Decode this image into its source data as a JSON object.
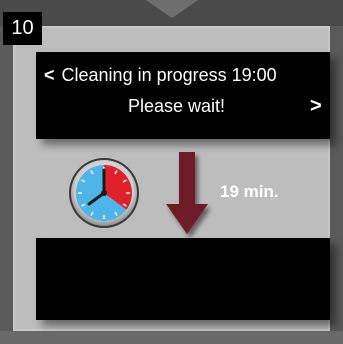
{
  "step": {
    "number": "10"
  },
  "display": {
    "prev_chevron": "<",
    "line1": "Cleaning in progress 19:00",
    "line2": "Please wait!",
    "next_chevron": ">"
  },
  "timer": {
    "remaining": "19 min."
  },
  "icons": {
    "clock": "stopwatch-clock-icon",
    "arrow": "down-arrow-icon"
  },
  "colors": {
    "clock_face": "#4fb4e8",
    "clock_sector": "#e0202a",
    "arrow": "#6e1f2c"
  }
}
